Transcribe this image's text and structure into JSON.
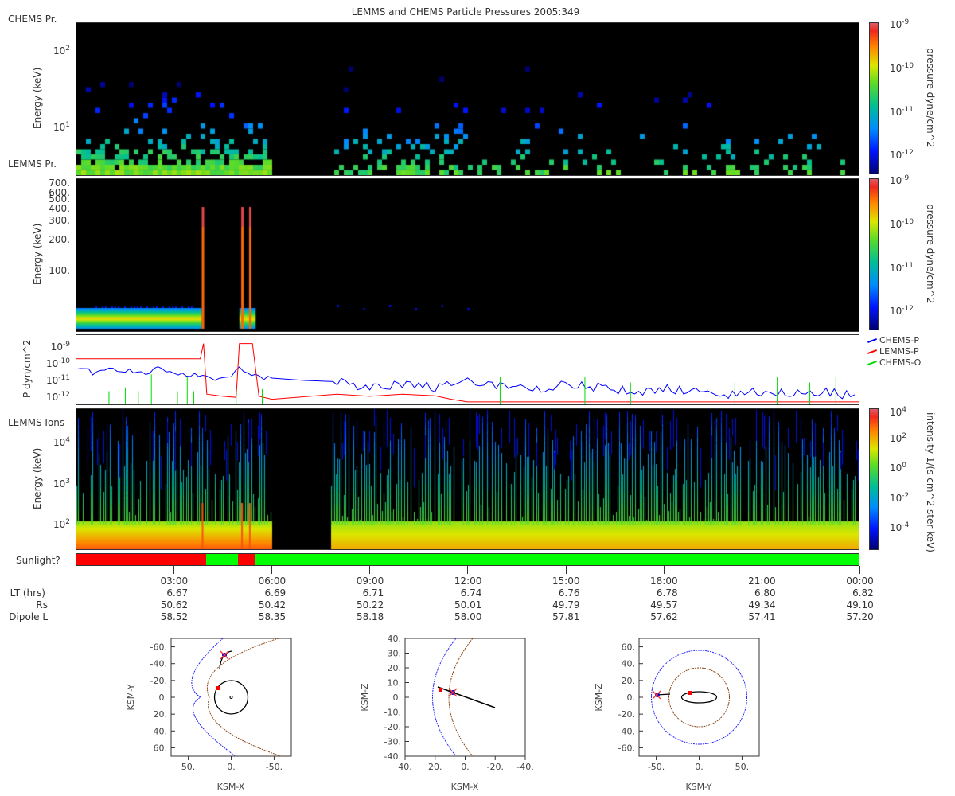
{
  "title": "LEMMS and CHEMS Particle Pressures  2005:349",
  "panels": {
    "chems_label": "CHEMS Pr.",
    "lemms_label": "LEMMS Pr.",
    "ions_label": "LEMMS Ions",
    "energy_ylabel": "Energy (keV)",
    "pressure_ylabel": "P dyn/cm^2",
    "panel1_yticks": [
      {
        "b": "10",
        "e": "2"
      },
      {
        "b": "10",
        "e": "1"
      }
    ],
    "panel2_yticks": [
      "700.",
      "600.",
      "500.",
      "400.",
      "300.",
      "200.",
      "100."
    ],
    "panel3_yticks": [
      {
        "b": "10",
        "e": "-9"
      },
      {
        "b": "10",
        "e": "-10"
      },
      {
        "b": "10",
        "e": "-11"
      },
      {
        "b": "10",
        "e": "-12"
      }
    ],
    "panel4_yticks": [
      {
        "b": "10",
        "e": "4"
      },
      {
        "b": "10",
        "e": "3"
      },
      {
        "b": "10",
        "e": "2"
      }
    ]
  },
  "colorbars": {
    "pressure_label": "pressure dyne/cm^2",
    "pressure_ticks": [
      {
        "b": "10",
        "e": "-9"
      },
      {
        "b": "10",
        "e": "-10"
      },
      {
        "b": "10",
        "e": "-11"
      },
      {
        "b": "10",
        "e": "-12"
      }
    ],
    "intensity_label": "intensity 1/(s cm^2 ster keV)",
    "intensity_ticks": [
      {
        "b": "10",
        "e": "4"
      },
      {
        "b": "10",
        "e": "2"
      },
      {
        "b": "10",
        "e": "0"
      },
      {
        "b": "10",
        "e": "-2"
      },
      {
        "b": "10",
        "e": "-4"
      }
    ]
  },
  "legend": [
    {
      "label": "CHEMS-P",
      "color": "#0000ff"
    },
    {
      "label": "LEMMS-P",
      "color": "#ff0000"
    },
    {
      "label": "CHEMS-O",
      "color": "#00dd00"
    }
  ],
  "sunlight": {
    "label": "Sunlight?",
    "segments": [
      {
        "start": 0,
        "end": 3.97,
        "state": "shadow",
        "color": "#ff0000"
      },
      {
        "start": 3.97,
        "end": 4.95,
        "state": "sun",
        "color": "#00ff00"
      },
      {
        "start": 4.95,
        "end": 5.46,
        "state": "shadow",
        "color": "#ff0000"
      },
      {
        "start": 5.46,
        "end": 24,
        "state": "sun",
        "color": "#00ff00"
      }
    ]
  },
  "ephemeris": {
    "row_labels": [
      "LT (hrs)",
      "Rs",
      "Dipole L"
    ],
    "columns": [
      {
        "time": "03:00",
        "lt": "6.67",
        "rs": "50.62",
        "l": "58.52"
      },
      {
        "time": "06:00",
        "lt": "6.69",
        "rs": "50.42",
        "l": "58.35"
      },
      {
        "time": "09:00",
        "lt": "6.71",
        "rs": "50.22",
        "l": "58.18"
      },
      {
        "time": "12:00",
        "lt": "6.74",
        "rs": "50.01",
        "l": "58.00"
      },
      {
        "time": "15:00",
        "lt": "6.76",
        "rs": "49.79",
        "l": "57.81"
      },
      {
        "time": "18:00",
        "lt": "6.78",
        "rs": "49.57",
        "l": "57.62"
      },
      {
        "time": "21:00",
        "lt": "6.80",
        "rs": "49.34",
        "l": "57.41"
      },
      {
        "time": "00:00",
        "lt": "6.82",
        "rs": "49.10",
        "l": "57.20"
      }
    ]
  },
  "orbits": [
    {
      "xlabel": "KSM-X",
      "ylabel": "KSM-Y",
      "xticks": [
        "50.",
        "0.",
        "-50."
      ],
      "yticks": [
        "-60.",
        "-40.",
        "-20.",
        "0.",
        "20.",
        "40.",
        "60."
      ]
    },
    {
      "xlabel": "KSM-X",
      "ylabel": "KSM-Z",
      "xticks": [
        "40.",
        "20.",
        "0.",
        "-20.",
        "-40."
      ],
      "yticks": [
        "40.",
        "30.",
        "20.",
        "10.",
        "0.",
        "-10.",
        "-20.",
        "-30.",
        "-40."
      ]
    },
    {
      "xlabel": "KSM-Y",
      "ylabel": "KSM-Z",
      "xticks": [
        "-50.",
        "0.",
        "50."
      ],
      "yticks": [
        "60.",
        "40.",
        "20.",
        "0.",
        "-20.",
        "-40.",
        "-60."
      ]
    }
  ],
  "chart_data": [
    {
      "type": "heatmap",
      "title": "CHEMS Pr.",
      "ylabel": "Energy (keV)",
      "yscale": "log",
      "ylim": [
        3,
        250
      ],
      "xlim_hours": [
        0,
        24
      ],
      "data_gap_hours": [
        5.97,
        7.8
      ],
      "colorbar": "pressure dyne/cm^2",
      "clim": [
        5e-13,
        1e-09
      ]
    },
    {
      "type": "heatmap",
      "title": "LEMMS Pr.",
      "ylabel": "Energy (keV)",
      "yscale": "log",
      "ylim": [
        30,
        800
      ],
      "spikes_hours": [
        3.9,
        5.1,
        5.3
      ],
      "colorbar": "pressure dyne/cm^2",
      "clim": [
        5e-13,
        1e-09
      ]
    },
    {
      "type": "line",
      "ylabel": "P dyn/cm^2",
      "yscale": "log",
      "ylim": [
        6e-13,
        2e-09
      ],
      "series": [
        {
          "name": "CHEMS-P",
          "hours": [
            0,
            0.5,
            1,
            1.5,
            2,
            2.5,
            3,
            3.5,
            4,
            4.5,
            5,
            5.5,
            6,
            7,
            8,
            8.5,
            9,
            10,
            11,
            12,
            13,
            14,
            15,
            16,
            17,
            18,
            19,
            20,
            21,
            22,
            23,
            24
          ],
          "values": [
            6e-11,
            4e-11,
            6e-11,
            5e-11,
            3e-11,
            6e-11,
            4e-11,
            3e-11,
            2e-11,
            1.5e-11,
            6e-11,
            2.5e-11,
            1.8e-11,
            1.3e-11,
            1.1e-11,
            7e-12,
            6e-12,
            8e-12,
            5e-12,
            1e-11,
            6e-12,
            4e-12,
            8e-12,
            5e-12,
            3e-12,
            4e-12,
            3e-12,
            2e-12,
            3e-12,
            2e-12,
            2.5e-12,
            1.5e-12
          ]
        },
        {
          "name": "LEMMS-P",
          "hours": [
            0,
            3.8,
            3.9,
            4.0,
            4.5,
            4.9,
            5.0,
            5.4,
            5.6,
            6.0,
            8,
            9,
            10,
            11,
            11.5,
            12,
            18,
            24
          ],
          "values": [
            2.5e-10,
            2.5e-10,
            2e-09,
            2e-12,
            1.5e-12,
            1.3e-12,
            2e-09,
            2e-09,
            1.5e-12,
            1e-12,
            2e-12,
            1.5e-12,
            2e-12,
            1.6e-12,
            1e-12,
            7e-13,
            7e-13,
            7e-13
          ]
        },
        {
          "name": "CHEMS-O",
          "spike_hours": [
            1,
            1.5,
            1.9,
            2.3,
            3.1,
            3.4,
            3.6,
            4.9,
            5.7,
            13,
            15.6,
            17,
            20.2,
            21.5,
            22.5,
            23.3
          ],
          "values": [
            3e-12,
            5e-12,
            3e-12,
            3e-11,
            3e-12,
            2e-11,
            3e-12,
            4e-12,
            4e-12,
            2e-11,
            2e-11,
            1e-11,
            1e-11,
            2e-11,
            1e-11,
            2e-11
          ]
        }
      ]
    },
    {
      "type": "heatmap",
      "title": "LEMMS Ions",
      "ylabel": "Energy (keV)",
      "yscale": "log",
      "ylim": [
        30,
        60000
      ],
      "data_gap_hours": [
        5.97,
        7.8
      ],
      "colorbar": "intensity 1/(s cm^2 ster keV)",
      "clim": [
        1e-05,
        10000.0
      ]
    }
  ]
}
